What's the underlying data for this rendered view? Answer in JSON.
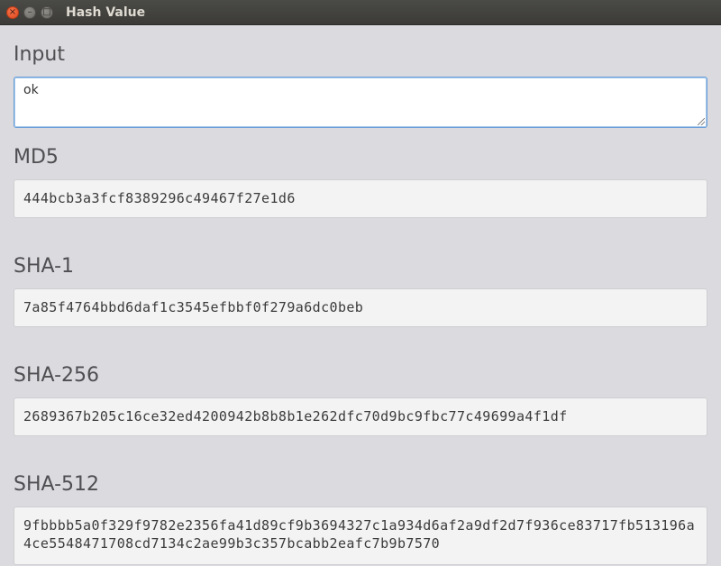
{
  "window": {
    "title": "Hash Value",
    "buttons": {
      "close": "×",
      "minimize": "–",
      "maximize": "□"
    }
  },
  "input": {
    "label": "Input",
    "value": "ok"
  },
  "hashes": {
    "md5": {
      "label": "MD5",
      "value": "444bcb3a3fcf8389296c49467f27e1d6"
    },
    "sha1": {
      "label": "SHA-1",
      "value": "7a85f4764bbd6daf1c3545efbbf0f279a6dc0beb"
    },
    "sha256": {
      "label": "SHA-256",
      "value": "2689367b205c16ce32ed4200942b8b8b1e262dfc70d9bc9fbc77c49699a4f1df"
    },
    "sha512": {
      "label": "SHA-512",
      "value": "9fbbbb5a0f329f9782e2356fa41d89cf9b3694327c1a934d6af2a9df2d7f936ce83717fb513196a4ce5548471708cd7134c2ae99b3c357bcabb2eafc7b9b7570"
    }
  }
}
